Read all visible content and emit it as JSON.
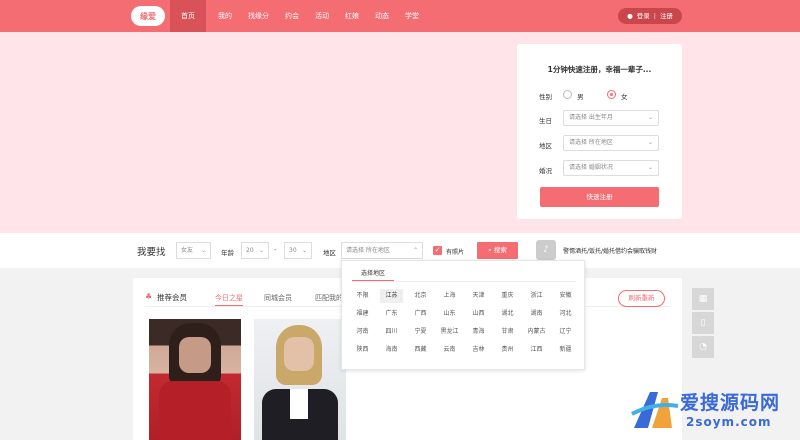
{
  "header": {
    "logo_text": "缘爱",
    "nav": [
      "首页",
      "我的",
      "找缘分",
      "约会",
      "活动",
      "红娘",
      "动态",
      "学堂"
    ],
    "login": "登录",
    "register": "注册"
  },
  "register_form": {
    "title": "1分钟快速注册，幸福一辈子...",
    "gender_label": "性别",
    "gender_male": "男",
    "gender_female": "女",
    "gender_selected": "女",
    "birthday_label": "生日",
    "birthday_placeholder": "请选择   出生年月",
    "region_label": "地区",
    "region_placeholder": "请选择   所在地区",
    "marriage_label": "婚况",
    "marriage_placeholder": "请选择   婚姻状况",
    "submit": "快速注册"
  },
  "search": {
    "title": "我要找",
    "gender_value": "女友",
    "age_label": "年龄",
    "age_min": "20",
    "age_dash": "-",
    "age_max": "30",
    "region_label": "地区",
    "region_placeholder": "请选择   所在地区",
    "photo_label": "有照片",
    "photo_checked": true,
    "button": "搜索",
    "notice": "警惕酒托/饭托/婚托借约会骗取钱财"
  },
  "region_dropdown": {
    "tab": "选择地区",
    "selected": "江苏",
    "cells": [
      "不限",
      "江苏",
      "北京",
      "上海",
      "天津",
      "重庆",
      "浙江",
      "安徽",
      "福建",
      "广东",
      "广西",
      "山东",
      "山西",
      "湖北",
      "湖南",
      "河北",
      "河南",
      "四川",
      "宁夏",
      "黑龙江",
      "青海",
      "甘肃",
      "内蒙古",
      "辽宁",
      "陕西",
      "海南",
      "西藏",
      "云南",
      "吉林",
      "贵州",
      "江西",
      "新疆"
    ]
  },
  "members": {
    "title": "推荐会员",
    "tabs": [
      "今日之星",
      "同城会员",
      "匹配我的"
    ],
    "active_tab": "今日之星",
    "refresh": "刷新重新"
  },
  "watermark": {
    "cn": "爱搜源码网",
    "en": "2soym.com"
  },
  "colors": {
    "accent": "#f46d72",
    "banner": "#ffe5ea"
  }
}
